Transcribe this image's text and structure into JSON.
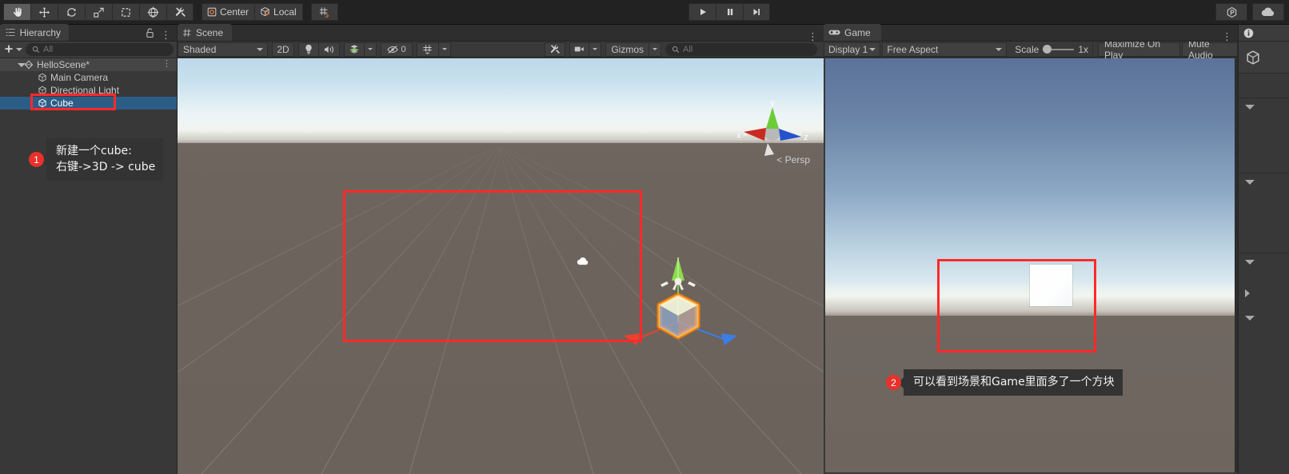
{
  "app": {
    "name": "Unity Editor"
  },
  "toolbar": {
    "tools": [
      {
        "name": "hand-tool",
        "icon": "hand-icon",
        "active": true
      },
      {
        "name": "move-tool",
        "icon": "move-icon",
        "active": false
      },
      {
        "name": "rotate-tool",
        "icon": "rotate-icon",
        "active": false
      },
      {
        "name": "scale-tool",
        "icon": "scale-icon",
        "active": false
      },
      {
        "name": "rect-tool",
        "icon": "rect-transform-icon",
        "active": false
      },
      {
        "name": "transform-tool",
        "icon": "transform-icon",
        "active": false
      },
      {
        "name": "custom-tool",
        "icon": "tools-icon",
        "active": false
      }
    ],
    "pivot_label": "Center",
    "rotation_label": "Local",
    "snap_label": "",
    "play_label": "Play",
    "pause_label": "Pause",
    "step_label": "Step",
    "collab_label": "Collab",
    "cloud_label": "Services"
  },
  "hierarchy": {
    "tab_label": "Hierarchy",
    "add_label": "+",
    "search_placeholder": "All",
    "search_value": "",
    "scene_name": "HelloScene*",
    "objects": [
      {
        "label": "Main Camera",
        "selected": false
      },
      {
        "label": "Directional Light",
        "selected": false
      },
      {
        "label": "Cube",
        "selected": true
      }
    ]
  },
  "scene": {
    "tab_label": "Scene",
    "draw_mode": "Shaded",
    "mode_2d_label": "2D",
    "lighting_label": "Lighting",
    "audio_label": "Audio",
    "effects_label": "Effects",
    "hidden_count": "0",
    "grid_label": "Grid",
    "tool_settings_label": "Tool Settings",
    "camera_label": "Scene Camera",
    "gizmos_label": "Gizmos",
    "search_placeholder": "All",
    "search_value": "",
    "perspective_label": "< Persp",
    "axis_x": "x",
    "axis_y": "y",
    "axis_z": "z"
  },
  "game": {
    "tab_label": "Game",
    "display_label": "Display 1",
    "aspect_label": "Free Aspect",
    "scale_label": "Scale",
    "scale_value": "1x",
    "maximize_label": "Maximize On Play",
    "mute_label": "Mute Audio"
  },
  "inspector": {
    "tab_label": "Inspector"
  },
  "annotations": [
    {
      "number": "1",
      "text": "新建一个cube:\n右键->3D -> cube"
    },
    {
      "number": "2",
      "text": "可以看到场景和Game里面多了一个方块"
    }
  ],
  "colors": {
    "accent_red": "#ff2a2a",
    "badge_red": "#e8312a",
    "selection_blue": "#2c5d87",
    "panel_bg": "#383838",
    "toolbar_bg": "#222222",
    "gizmo_x": "#e4413a",
    "gizmo_y": "#8cdd4a",
    "gizmo_z": "#3b7fe0",
    "selection_outline": "#ff8000"
  }
}
